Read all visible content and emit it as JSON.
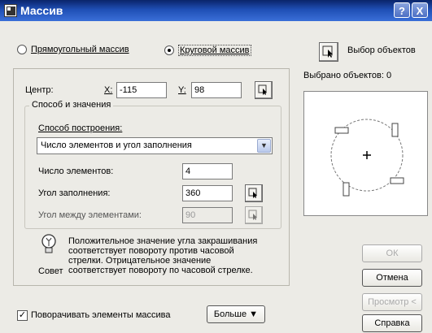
{
  "window": {
    "title": "Массив",
    "help_btn": "?",
    "close_btn": "X"
  },
  "mode": {
    "rect_label": "Прямоугольный массив",
    "polar_label": "Круговой массив",
    "selected": "polar"
  },
  "select_objects": {
    "button_label": "Выбор объектов",
    "selected_text": "Выбрано объектов: 0"
  },
  "center": {
    "label": "Центр:",
    "x_label": "X:",
    "x_value": "-115",
    "y_label": "Y:",
    "y_value": "98"
  },
  "method_group": {
    "title": "Способ и значения",
    "method_label": "Способ построения:",
    "method_value": "Число элементов и угол заполнения",
    "count_label": "Число элементов:",
    "count_value": "4",
    "fill_angle_label": "Угол заполнения:",
    "fill_angle_value": "360",
    "between_angle_label": "Угол между элементами:",
    "between_angle_value": "90"
  },
  "tip": {
    "label": "Совет",
    "text_line1": "Положительное значение угла закрашивания",
    "text_line2": "соответствует повороту против часовой",
    "text_line3": "стрелки. Отрицательное значение",
    "text_line4": "соответствует повороту по часовой стрелке."
  },
  "rotate": {
    "label": "Поворачивать элементы массива",
    "checked": true
  },
  "buttons": {
    "more": "Больше ▼",
    "ok": "ОК",
    "cancel": "Отмена",
    "preview": "Просмотр <",
    "help": "Справка"
  }
}
